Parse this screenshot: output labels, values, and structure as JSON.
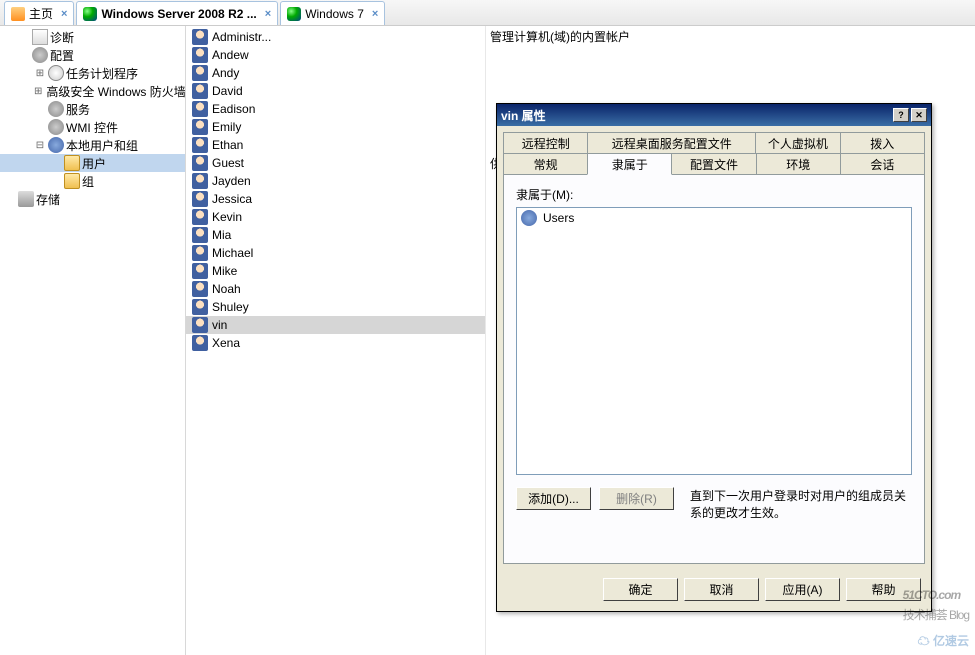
{
  "tabs": [
    {
      "label": "主页",
      "icon": "home-icon"
    },
    {
      "label": "Windows Server 2008 R2 ...",
      "icon": "vm-icon",
      "active": true
    },
    {
      "label": "Windows 7",
      "icon": "vm-icon"
    }
  ],
  "tree": {
    "items": [
      {
        "label": "诊断",
        "icon": "diag",
        "indent": 1,
        "toggle": ""
      },
      {
        "label": "配置",
        "icon": "gear",
        "indent": 1,
        "toggle": ""
      },
      {
        "label": "任务计划程序",
        "icon": "clock",
        "indent": 2,
        "toggle": "+"
      },
      {
        "label": "高级安全 Windows 防火墙",
        "icon": "shield",
        "indent": 2,
        "toggle": "+"
      },
      {
        "label": "服务",
        "icon": "gear",
        "indent": 2,
        "toggle": ""
      },
      {
        "label": "WMI 控件",
        "icon": "gear",
        "indent": 2,
        "toggle": ""
      },
      {
        "label": "本地用户和组",
        "icon": "group",
        "indent": 2,
        "toggle": "-"
      },
      {
        "label": "用户",
        "icon": "folder",
        "indent": 3,
        "toggle": "",
        "selected": true
      },
      {
        "label": "组",
        "icon": "folder",
        "indent": 3,
        "toggle": ""
      },
      {
        "label": "存储",
        "icon": "disk",
        "indent": 0,
        "toggle": ""
      }
    ]
  },
  "users": [
    "Administr...",
    "Andew",
    "Andy",
    "David",
    "Eadison",
    "Emily",
    "Ethan",
    "Guest",
    "Jayden",
    "Jessica",
    "Kevin",
    "Mia",
    "Michael",
    "Mike",
    "Noah",
    "Shuley",
    "vin",
    "Xena"
  ],
  "selected_user": "vin",
  "desc": {
    "line1": "管理计算机(域)的内置帐户",
    "line2": "供来宾访"
  },
  "dialog": {
    "title": "vin 属性",
    "tabs_row1": [
      "远程控制",
      "远程桌面服务配置文件",
      "个人虚拟机",
      "拨入"
    ],
    "tabs_row2": [
      "常规",
      "隶属于",
      "配置文件",
      "环境",
      "会话"
    ],
    "active_tab": "隶属于",
    "field_label": "隶属于(M):",
    "members": [
      "Users"
    ],
    "add_btn": "添加(D)...",
    "remove_btn": "删除(R)",
    "hint": "直到下一次用户登录时对用户的组成员关系的更改才生效。",
    "ok": "确定",
    "cancel": "取消",
    "apply": "应用(A)",
    "help": "帮助"
  },
  "watermark": {
    "main": "51CTO.com",
    "sub": "技术捕荟 Blog",
    "yisu": "亿速云"
  }
}
